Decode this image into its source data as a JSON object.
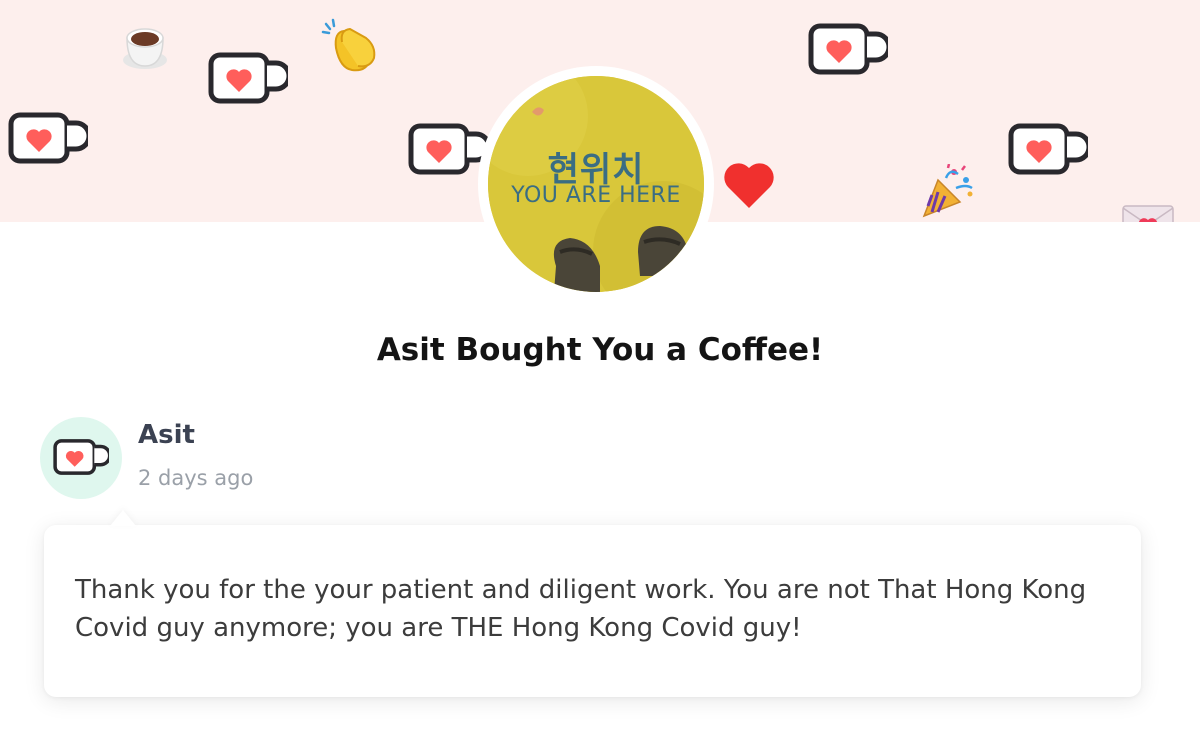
{
  "page": {
    "headline": "Asit Bought You a Coffee!"
  },
  "profile": {
    "avatar_korean_text": "현위치",
    "avatar_english_text": "YOU ARE HERE"
  },
  "supporter": {
    "name": "Asit",
    "time": "2 days ago",
    "avatar_icon": "coffee-mug-heart-icon"
  },
  "message": {
    "text": "Thank you for the your patient and diligent work. You are not That Hong Kong Covid guy anymore; you are THE Hong Kong Covid guy!"
  },
  "decorations": {
    "icons": [
      "coffee-cup-icon",
      "coffee-mug-heart-icon",
      "clapping-hands-icon",
      "heart-icon",
      "party-popper-icon",
      "love-letter-icon"
    ]
  },
  "colors": {
    "banner_bg": "#fdefed",
    "heart_red": "#ff5e5b",
    "mug_outline": "#29282d",
    "supporter_avatar_bg": "#dff7ee",
    "headline": "#141414"
  }
}
